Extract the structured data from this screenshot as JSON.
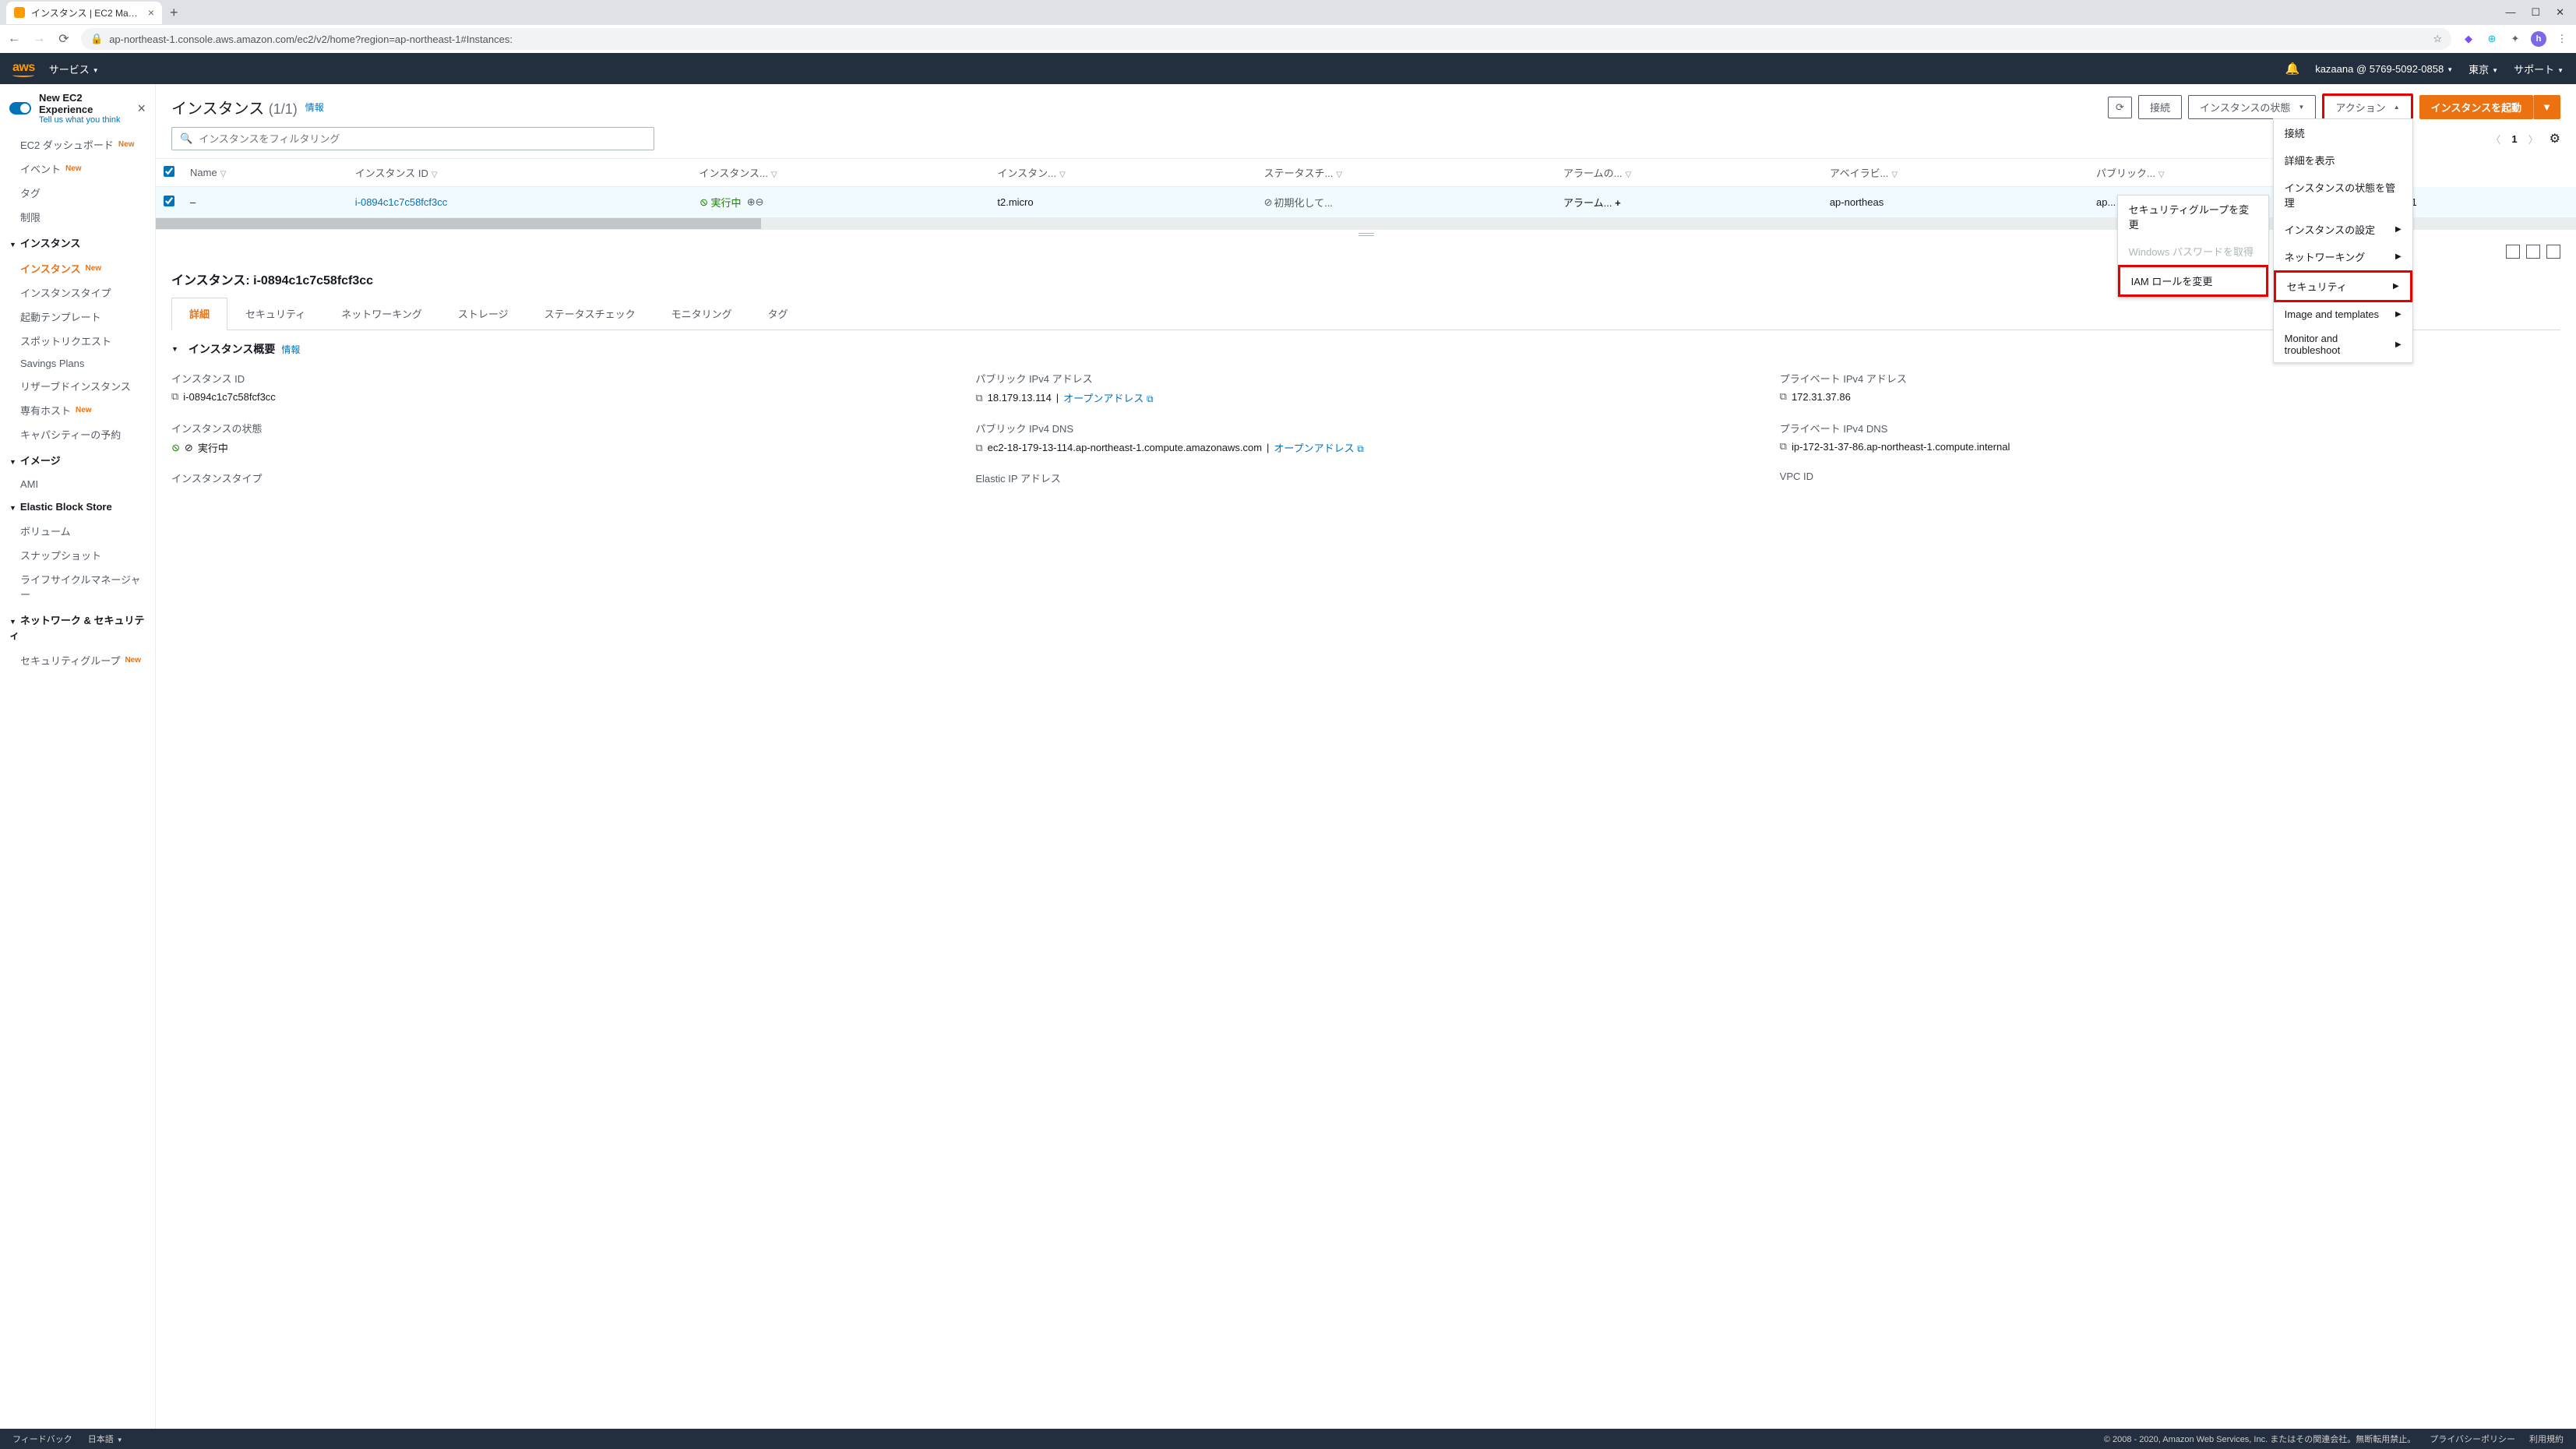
{
  "browser": {
    "tab_title": "インスタンス | EC2 Management Co",
    "url": "ap-northeast-1.console.aws.amazon.com/ec2/v2/home?region=ap-northeast-1#Instances:"
  },
  "header": {
    "logo": "aws",
    "services": "サービス",
    "account": "kazaana @ 5769-5092-0858",
    "region": "東京",
    "support": "サポート"
  },
  "new_experience": {
    "title": "New EC2 Experience",
    "subtitle": "Tell us what you think"
  },
  "sidebar": {
    "top": [
      {
        "label": "EC2 ダッシュボード",
        "new": true
      },
      {
        "label": "イベント",
        "new": true
      },
      {
        "label": "タグ",
        "new": false
      },
      {
        "label": "制限",
        "new": false
      }
    ],
    "sections": [
      {
        "title": "インスタンス",
        "items": [
          {
            "label": "インスタンス",
            "new": true,
            "active": true
          },
          {
            "label": "インスタンスタイプ",
            "new": false
          },
          {
            "label": "起動テンプレート",
            "new": false
          },
          {
            "label": "スポットリクエスト",
            "new": false
          },
          {
            "label": "Savings Plans",
            "new": false
          },
          {
            "label": "リザーブドインスタンス",
            "new": false
          },
          {
            "label": "専有ホスト",
            "new": true
          },
          {
            "label": "キャパシティーの予約",
            "new": false
          }
        ]
      },
      {
        "title": "イメージ",
        "items": [
          {
            "label": "AMI",
            "new": false
          }
        ]
      },
      {
        "title": "Elastic Block Store",
        "items": [
          {
            "label": "ボリューム",
            "new": false
          },
          {
            "label": "スナップショット",
            "new": false
          },
          {
            "label": "ライフサイクルマネージャー",
            "new": false
          }
        ]
      },
      {
        "title": "ネットワーク & セキュリティ",
        "items": [
          {
            "label": "セキュリティグループ",
            "new": true
          }
        ]
      }
    ]
  },
  "page": {
    "title": "インスタンス",
    "count": "(1/1)",
    "info": "情報",
    "btn_connect": "接続",
    "btn_state": "インスタンスの状態",
    "btn_actions": "アクション",
    "btn_launch": "インスタンスを起動",
    "search_placeholder": "インスタンスをフィルタリング",
    "page_num": "1"
  },
  "actions_menu": [
    {
      "label": "接続",
      "sub": false
    },
    {
      "label": "詳細を表示",
      "sub": false
    },
    {
      "label": "インスタンスの状態を管理",
      "sub": false
    },
    {
      "label": "インスタンスの設定",
      "sub": true
    },
    {
      "label": "ネットワーキング",
      "sub": true
    },
    {
      "label": "セキュリティ",
      "sub": true,
      "highlight": true
    },
    {
      "label": "Image and templates",
      "sub": true
    },
    {
      "label": "Monitor and troubleshoot",
      "sub": true
    }
  ],
  "security_submenu": [
    {
      "label": "セキュリティグループを変更",
      "disabled": false
    },
    {
      "label": "Windows パスワードを取得",
      "disabled": true
    },
    {
      "label": "IAM ロールを変更",
      "disabled": false,
      "highlight": true
    }
  ],
  "table": {
    "cols": [
      "Name",
      "インスタンス ID",
      "インスタンス...",
      "インスタン...",
      "ステータスチ...",
      "アラームの...",
      "アベイラビ...",
      "パブリック..."
    ],
    "row": {
      "name": "–",
      "instance_id": "i-0894c1c7c58fcf3cc",
      "state": "実行中",
      "type": "t2.micro",
      "status_check": "初期化して...",
      "alarm": "アラーム...",
      "az": "ap-northeas",
      "az_suffix": "ap...",
      "public_ip": "18.179.13.1"
    }
  },
  "details": {
    "title_prefix": "インスタンス:",
    "instance_id": "i-0894c1c7c58fcf3cc",
    "tabs": [
      "詳細",
      "セキュリティ",
      "ネットワーキング",
      "ストレージ",
      "ステータスチェック",
      "モニタリング",
      "タグ"
    ],
    "section_title": "インスタンス概要",
    "info": "情報",
    "fields": {
      "instance_id_label": "インスタンス ID",
      "instance_id_value": "i-0894c1c7c58fcf3cc",
      "public_ipv4_label": "パブリック IPv4 アドレス",
      "public_ipv4_value": "18.179.13.114",
      "open_address": "オープンアドレス",
      "private_ipv4_label": "プライベート IPv4 アドレス",
      "private_ipv4_value": "172.31.37.86",
      "state_label": "インスタンスの状態",
      "state_value": "実行中",
      "public_dns_label": "パブリック IPv4 DNS",
      "public_dns_value": "ec2-18-179-13-114.ap-northeast-1.compute.amazonaws.com",
      "private_dns_label": "プライベート IPv4 DNS",
      "private_dns_value": "ip-172-31-37-86.ap-northeast-1.compute.internal",
      "type_label": "インスタンスタイプ",
      "eip_label": "Elastic IP アドレス",
      "vpc_label": "VPC ID"
    }
  },
  "footer": {
    "feedback": "フィードバック",
    "language": "日本語",
    "copyright": "© 2008 - 2020, Amazon Web Services, Inc. またはその関連会社。無断転用禁止。",
    "privacy": "プライバシーポリシー",
    "terms": "利用規約"
  }
}
